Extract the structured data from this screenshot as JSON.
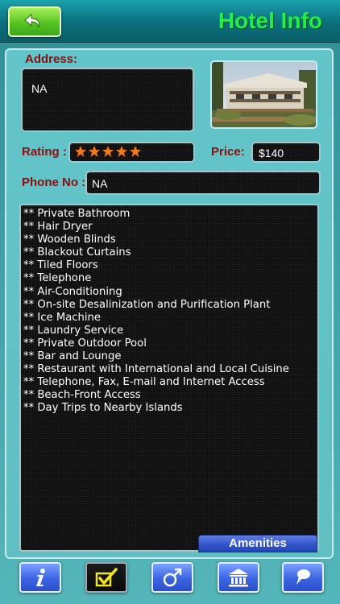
{
  "header": {
    "title": "Hotel Info"
  },
  "labels": {
    "address": "Address:",
    "rating": "Rating :",
    "price": "Price:",
    "phone": "Phone No :"
  },
  "values": {
    "address": "NA",
    "price": "$140",
    "phone": "NA",
    "rating_stars": 5
  },
  "amenities": {
    "tab_label": "Amenities",
    "items": [
      "** Private Bathroom",
      "** Hair Dryer",
      "** Wooden Blinds",
      "** Blackout Curtains",
      "** Tiled Floors",
      "** Telephone",
      "** Air-Conditioning",
      "** On-site Desalinization and Purification Plant",
      "** Ice Machine",
      "** Laundry Service",
      "** Private Outdoor Pool",
      "** Bar and Lounge",
      "** Restaurant with International and Local Cuisine",
      "** Telephone, Fax, E-mail and Internet Access",
      "** Beach-Front Access",
      "** Day Trips to Nearby Islands"
    ]
  },
  "colors": {
    "title": "#22f04a",
    "label": "#8b0f0f",
    "star": "#f07a1a",
    "tab_blue": "#3b64e2"
  },
  "tabs": [
    {
      "icon": "info-icon",
      "active": false
    },
    {
      "icon": "checkmark-icon",
      "active": true
    },
    {
      "icon": "male-symbol-icon",
      "active": false
    },
    {
      "icon": "bank-building-icon",
      "active": false
    },
    {
      "icon": "pushpin-icon",
      "active": false
    }
  ]
}
